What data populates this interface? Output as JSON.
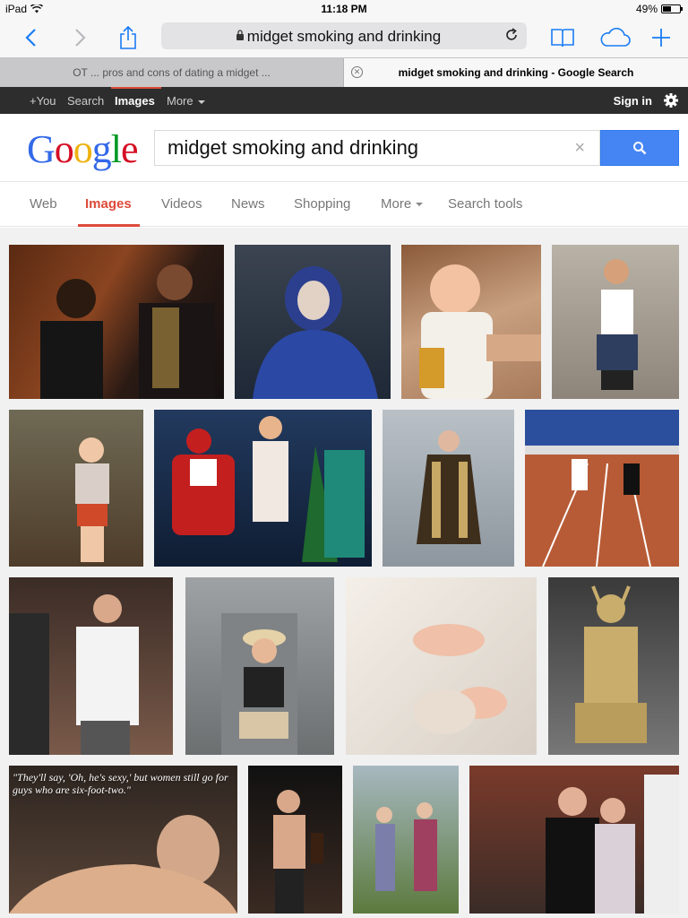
{
  "status_bar": {
    "device": "iPad",
    "time": "11:18 PM",
    "battery": "49%",
    "battery_level": 0.49
  },
  "browser": {
    "url": "midget smoking and drinking",
    "tabs": [
      {
        "title": "OT ... pros and cons of dating a midget ...",
        "active": false
      },
      {
        "title": "midget smoking and drinking - Google Search",
        "active": true
      }
    ],
    "icons": [
      "back-icon",
      "forward-icon",
      "share-icon",
      "lock-icon",
      "reload-icon",
      "bookmarks-icon",
      "icloud-tabs-icon",
      "new-tab-icon"
    ]
  },
  "google_bar": {
    "items": [
      "+You",
      "Search",
      "Images",
      "More"
    ],
    "active": "Images",
    "sign_in": "Sign in"
  },
  "search": {
    "logo": "Google",
    "query": "midget smoking and drinking",
    "clear": "×"
  },
  "result_nav": {
    "items": [
      "Web",
      "Images",
      "Videos",
      "News",
      "Shopping",
      "More",
      "Search tools"
    ],
    "active": "Images"
  },
  "results": {
    "caption_text": "\"They'll say, 'Oh, he's sexy,' but women still go for guys who are six-foot-two.\""
  },
  "colors": {
    "accent_blue": "#4585f3",
    "google_red": "#dd4b39",
    "safari_blue": "#1a7cf5",
    "bar_dark": "#2d2d2d"
  }
}
